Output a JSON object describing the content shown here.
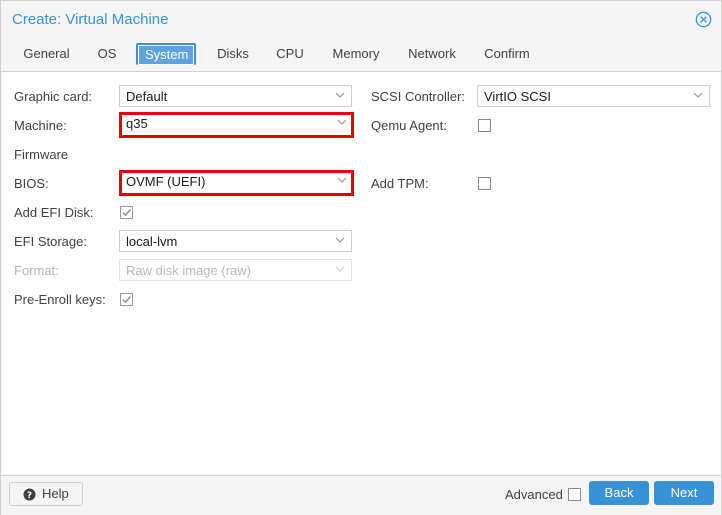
{
  "window": {
    "title": "Create: Virtual Machine",
    "close_icon": "close-circle-icon"
  },
  "tabs": [
    {
      "label": "General"
    },
    {
      "label": "OS"
    },
    {
      "label": "System",
      "active": true
    },
    {
      "label": "Disks"
    },
    {
      "label": "CPU"
    },
    {
      "label": "Memory"
    },
    {
      "label": "Network"
    },
    {
      "label": "Confirm"
    }
  ],
  "form": {
    "graphic_card": {
      "label": "Graphic card:",
      "value": "Default"
    },
    "machine": {
      "label": "Machine:",
      "value": "q35"
    },
    "firmware_heading": "Firmware",
    "bios": {
      "label": "BIOS:",
      "value": "OVMF (UEFI)"
    },
    "add_efi_disk": {
      "label": "Add EFI Disk:",
      "checked": true
    },
    "efi_storage": {
      "label": "EFI Storage:",
      "value": "local-lvm"
    },
    "format": {
      "label": "Format:",
      "value": "Raw disk image (raw)",
      "disabled": true
    },
    "pre_enroll_keys": {
      "label": "Pre-Enroll keys:",
      "checked": true
    },
    "scsi_controller": {
      "label": "SCSI Controller:",
      "value": "VirtIO SCSI"
    },
    "qemu_agent": {
      "label": "Qemu Agent:",
      "checked": false
    },
    "add_tpm": {
      "label": "Add TPM:",
      "checked": false
    }
  },
  "footer": {
    "help_label": "Help",
    "advanced_label": "Advanced",
    "advanced_checked": false,
    "back_label": "Back",
    "next_label": "Next"
  },
  "colors": {
    "accent": "#3892d4",
    "highlight": "#e4000f",
    "background": "#f5f5f5"
  }
}
